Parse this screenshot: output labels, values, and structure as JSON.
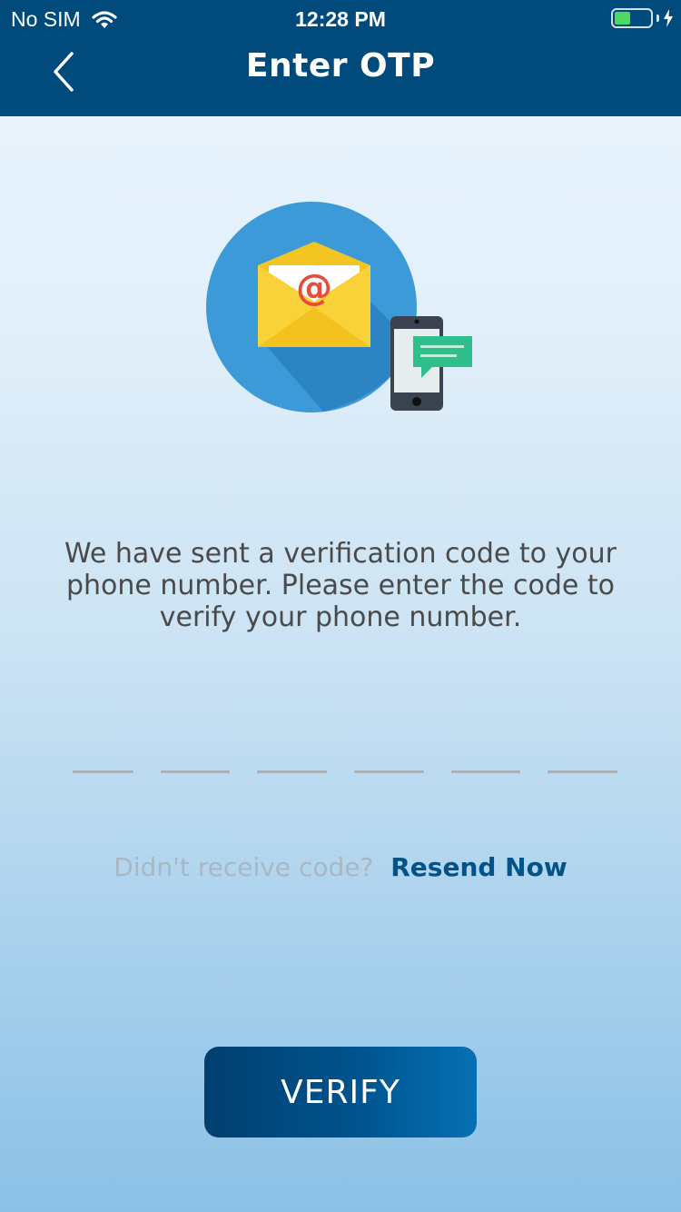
{
  "status_bar": {
    "carrier": "No SIM",
    "time": "12:28 PM",
    "battery_level": 0.45,
    "icons": [
      "wifi-icon",
      "battery-icon",
      "charging-bolt-icon"
    ]
  },
  "nav": {
    "title": "Enter OTP",
    "back_icon": "chevron-left-icon"
  },
  "illustration": {
    "icons": [
      "envelope-icon",
      "at-sign-icon",
      "phone-icon",
      "chat-bubble-icon"
    ],
    "at_symbol": "@"
  },
  "message": "We have sent a verification code to your phone number. Please enter the code to verify your phone number.",
  "otp": {
    "length": 6,
    "values": [
      "",
      "",
      "",
      "",
      "",
      ""
    ]
  },
  "resend": {
    "hint": "Didn't receive code?",
    "link": "Resend Now"
  },
  "verify_label": "VERIFY",
  "colors": {
    "header": "#004a7c",
    "accent": "#00548a",
    "hint": "#a9b7c2",
    "text": "#4a4a4a"
  }
}
